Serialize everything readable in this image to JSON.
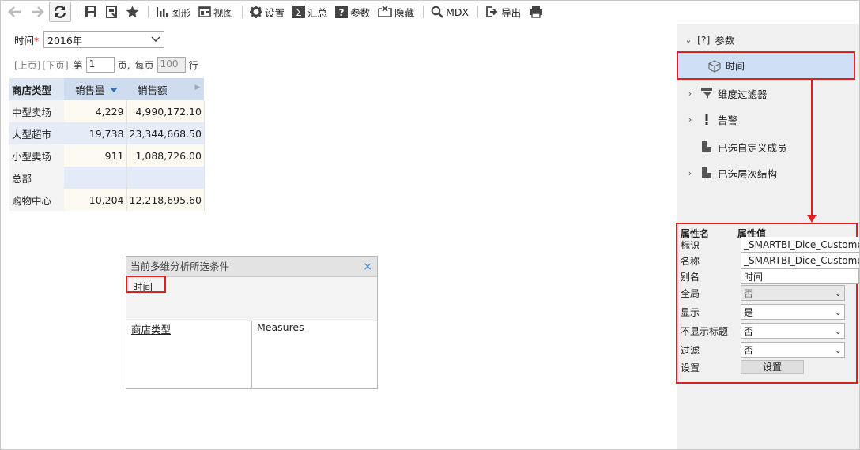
{
  "toolbar": {
    "chart_label": "图形",
    "view_label": "视图",
    "settings_label": "设置",
    "summary_label": "汇总",
    "params_label": "参数",
    "hide_label": "隐藏",
    "mdx_label": "MDX",
    "export_label": "导出"
  },
  "filter": {
    "label": "时间",
    "required_mark": "*",
    "value": "2016年"
  },
  "pager": {
    "prev": "[上页]",
    "next": "[下页]",
    "page_prefix": "第",
    "page_value": "1",
    "page_suffix": "页,",
    "per_page_label": "每页",
    "per_page_value": "100",
    "per_page_suffix": "行"
  },
  "table": {
    "headers": [
      "商店类型",
      "销售量",
      "销售额"
    ],
    "rows": [
      {
        "type": "中型卖场",
        "qty": "4,229",
        "amount": "4,990,172.10"
      },
      {
        "type": "大型超市",
        "qty": "19,738",
        "amount": "23,344,668.50"
      },
      {
        "type": "小型卖场",
        "qty": "911",
        "amount": "1,088,726.00"
      },
      {
        "type": "总部",
        "qty": "",
        "amount": ""
      },
      {
        "type": "购物中心",
        "qty": "10,204",
        "amount": "12,218,695.60"
      }
    ]
  },
  "dialog": {
    "title": "当前多维分析所选条件",
    "close": "×",
    "filter_item": "时间",
    "row_item": "商店类型",
    "column_item": "Measures"
  },
  "tree": {
    "params_label": "参数",
    "params_icon_text": "[?]",
    "time_label": "时间",
    "dim_filter_label": "维度过滤器",
    "alert_label": "告警",
    "custom_member_label": "已选自定义成员",
    "hierarchy_label": "已选层次结构"
  },
  "props": {
    "col_name": "属性名",
    "col_value": "属性值",
    "rows": [
      {
        "name": "标识",
        "value": "_SMARTBI_Dice_Customer"
      },
      {
        "name": "名称",
        "value": "_SMARTBI_Dice_Customer"
      },
      {
        "name": "别名",
        "value": "时间"
      },
      {
        "name": "全局",
        "value": "否"
      },
      {
        "name": "显示",
        "value": "是"
      },
      {
        "name": "不显示标题",
        "value": "否"
      },
      {
        "name": "过滤",
        "value": "否"
      },
      {
        "name": "设置",
        "value": "设置"
      }
    ]
  },
  "colors": {
    "highlight_red": "#e02020",
    "header_blue": "#dde6f3",
    "selected_blue": "#cfe0f6"
  }
}
